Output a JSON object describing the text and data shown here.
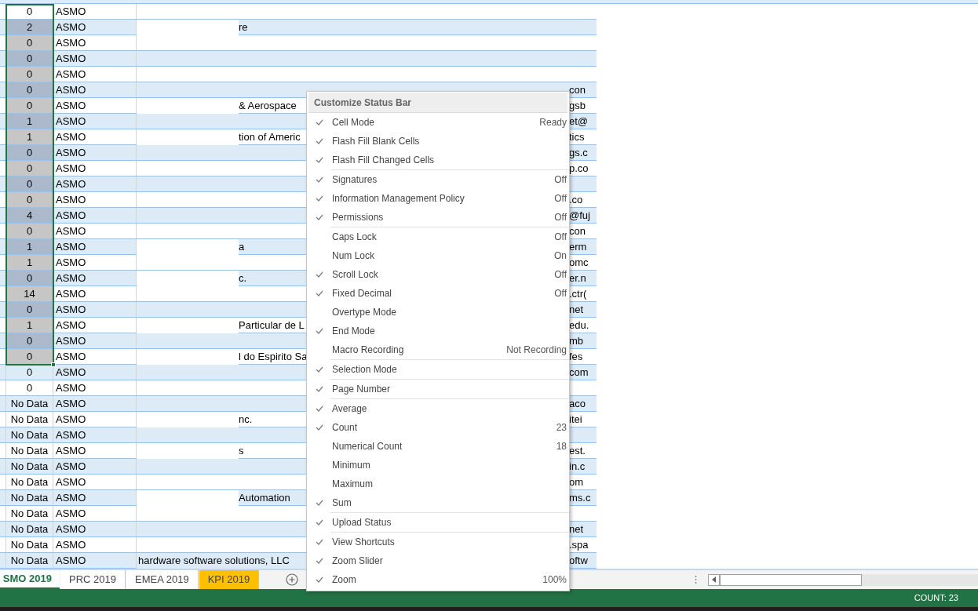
{
  "sheet": {
    "rows": [
      {
        "value": "0",
        "selected": true,
        "region": "ASMO",
        "column_6": ""
      },
      {
        "value": "2",
        "selected": true,
        "region": "ASMO",
        "company": "re",
        "masked": true,
        "column_6": ""
      },
      {
        "value": "0",
        "selected": true,
        "region": "ASMO",
        "column_6": ""
      },
      {
        "value": "0",
        "selected": true,
        "region": "ASMO",
        "column_6": ""
      },
      {
        "value": "0",
        "selected": true,
        "region": "ASMO",
        "column_6": ""
      },
      {
        "value": "0",
        "selected": true,
        "region": "ASMO",
        "column_6": "con"
      },
      {
        "value": "0",
        "selected": true,
        "region": "ASMO",
        "company": "& Aerospace",
        "masked": true,
        "column_6": "gsb"
      },
      {
        "value": "1",
        "selected": true,
        "region": "ASMO",
        "column_6": "et@"
      },
      {
        "value": "1",
        "selected": true,
        "region": "ASMO",
        "company": "tion of Americ",
        "masked": true,
        "column_6": "tics"
      },
      {
        "value": "0",
        "selected": true,
        "region": "ASMO",
        "column_6": "gs.c"
      },
      {
        "value": "0",
        "selected": true,
        "region": "ASMO",
        "column_6": "p.co"
      },
      {
        "value": "0",
        "selected": true,
        "region": "ASMO",
        "column_6": ""
      },
      {
        "value": "0",
        "selected": true,
        "region": "ASMO",
        "column_6": ".co"
      },
      {
        "value": "4",
        "selected": true,
        "region": "ASMO",
        "column_6": "@fuj"
      },
      {
        "value": "0",
        "selected": true,
        "region": "ASMO",
        "column_6": "con"
      },
      {
        "value": "1",
        "selected": true,
        "region": "ASMO",
        "company": "a",
        "masked": true,
        "column_6": "erm"
      },
      {
        "value": "1",
        "selected": true,
        "region": "ASMO",
        "column_6": "omc"
      },
      {
        "value": "0",
        "selected": true,
        "region": "ASMO",
        "company": "c.",
        "masked": true,
        "column_6": "er.n"
      },
      {
        "value": "14",
        "selected": true,
        "region": "ASMO",
        "column_6": ".ctr("
      },
      {
        "value": "0",
        "selected": true,
        "region": "ASMO",
        "column_6": "net"
      },
      {
        "value": "1",
        "selected": true,
        "region": "ASMO",
        "company": "Particular de L",
        "masked": true,
        "column_6": "edu."
      },
      {
        "value": "0",
        "selected": true,
        "region": "ASMO",
        "column_6": "mb"
      },
      {
        "value": "0",
        "selected": true,
        "region": "ASMO",
        "company": "l do Espirito Sa",
        "masked": true,
        "column_6": "fes"
      },
      {
        "value": "0",
        "selected": false,
        "region": "ASMO",
        "column_6": "com"
      },
      {
        "value": "0",
        "selected": false,
        "region": "ASMO",
        "column_6": ""
      },
      {
        "value": "No Data",
        "selected": false,
        "region": "ASMO",
        "column_6": "aco"
      },
      {
        "value": "No Data",
        "selected": false,
        "region": "ASMO",
        "company": "nc.",
        "masked": true,
        "column_6": "itei"
      },
      {
        "value": "No Data",
        "selected": false,
        "region": "ASMO",
        "column_6": ""
      },
      {
        "value": "No Data",
        "selected": false,
        "region": "ASMO",
        "company": "s",
        "masked": true,
        "column_6": "est."
      },
      {
        "value": "No Data",
        "selected": false,
        "region": "ASMO",
        "column_6": "in.c"
      },
      {
        "value": "No Data",
        "selected": false,
        "region": "ASMO",
        "column_6": "om"
      },
      {
        "value": "No Data",
        "selected": false,
        "region": "ASMO",
        "company": "Automation",
        "masked": true,
        "column_6": "ms.c"
      },
      {
        "value": "No Data",
        "selected": false,
        "region": "ASMO",
        "column_6": ""
      },
      {
        "value": "No Data",
        "selected": false,
        "region": "ASMO",
        "column_6": "net"
      },
      {
        "value": "No Data",
        "selected": false,
        "region": "ASMO",
        "column_6": ".spa"
      },
      {
        "value": "No Data",
        "selected": false,
        "region": "ASMO",
        "company": "hardware software solutions, LLC",
        "masked": false,
        "column_6": "oftw"
      }
    ]
  },
  "sheet_tabs": [
    {
      "label": "SMO 2019",
      "selected": true,
      "color": "#ffffff"
    },
    {
      "label": "PRC 2019",
      "selected": false,
      "color": "#ffffff"
    },
    {
      "label": "EMEA 2019",
      "selected": false,
      "color": "#ffffff"
    },
    {
      "label": "KPI 2019",
      "selected": false,
      "color": "#ffc000"
    }
  ],
  "status_bar": {
    "text": "COUNT: 23"
  },
  "context_menu": {
    "title": "Customize Status Bar",
    "groups": [
      [
        {
          "label": "Cell Mode",
          "checked": true,
          "value": "Ready"
        },
        {
          "label": "Flash Fill Blank Cells",
          "checked": true
        },
        {
          "label": "Flash Fill Changed Cells",
          "checked": true
        }
      ],
      [
        {
          "label": "Signatures",
          "checked": true,
          "value": "Off"
        },
        {
          "label": "Information Management Policy",
          "checked": true,
          "value": "Off"
        },
        {
          "label": "Permissions",
          "checked": true,
          "value": "Off"
        }
      ],
      [
        {
          "label": "Caps Lock",
          "checked": false,
          "value": "Off"
        },
        {
          "label": "Num Lock",
          "checked": false,
          "value": "On"
        },
        {
          "label": "Scroll Lock",
          "checked": true,
          "value": "Off"
        },
        {
          "label": "Fixed Decimal",
          "checked": true,
          "value": "Off"
        },
        {
          "label": "Overtype Mode",
          "checked": false
        },
        {
          "label": "End Mode",
          "checked": true
        },
        {
          "label": "Macro Recording",
          "checked": false,
          "value": "Not Recording"
        }
      ],
      [
        {
          "label": "Selection Mode",
          "checked": true
        }
      ],
      [
        {
          "label": "Page Number",
          "checked": true
        }
      ],
      [
        {
          "label": "Average",
          "checked": true
        },
        {
          "label": "Count",
          "checked": true,
          "value": "23"
        },
        {
          "label": "Numerical Count",
          "checked": false,
          "value": "18"
        },
        {
          "label": "Minimum",
          "checked": false
        },
        {
          "label": "Maximum",
          "checked": false
        },
        {
          "label": "Sum",
          "checked": true
        }
      ],
      [
        {
          "label": "Upload Status",
          "checked": true
        }
      ],
      [
        {
          "label": "View Shortcuts",
          "checked": true
        },
        {
          "label": "Zoom Slider",
          "checked": true
        },
        {
          "label": "Zoom",
          "checked": true,
          "value": "100%"
        }
      ]
    ]
  }
}
